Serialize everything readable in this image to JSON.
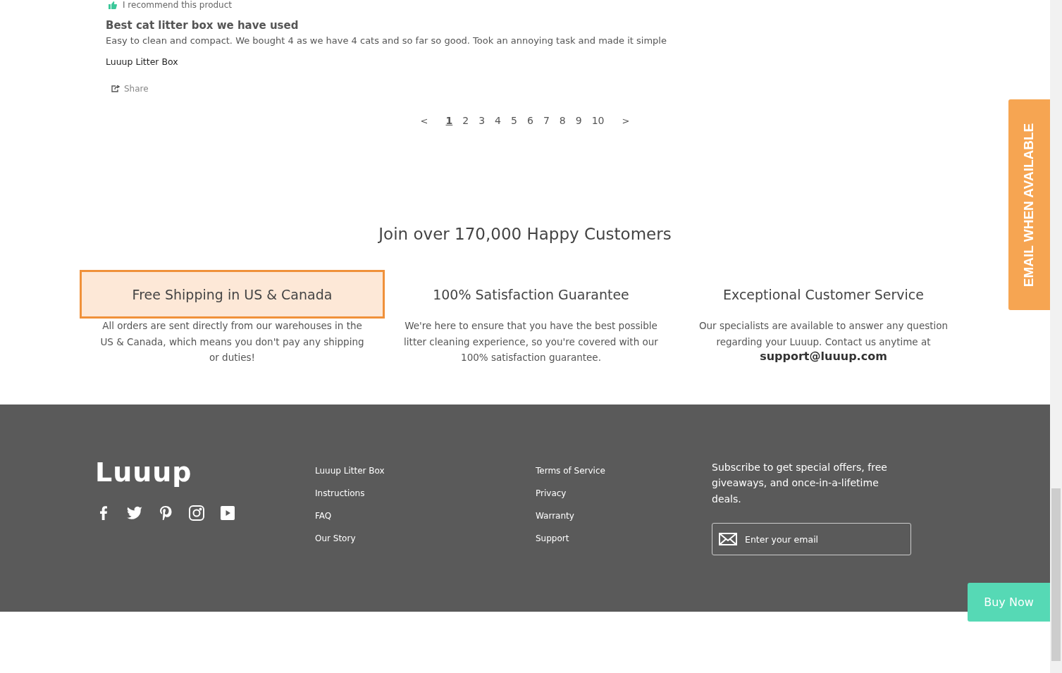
{
  "review": {
    "recommend": "I recommend this product",
    "title": "Best cat litter box we have used",
    "body": "Easy to clean and compact. We bought 4 as we have 4 cats and so far so good. Took an annoying task and made it simple",
    "product": "Luuup Litter Box",
    "share": "Share"
  },
  "pagination": {
    "prev": "<",
    "next": ">",
    "pages": [
      {
        "label": "1",
        "selected": true
      },
      {
        "label": "2",
        "selected": false
      },
      {
        "label": "3",
        "selected": false
      },
      {
        "label": "4",
        "selected": false
      },
      {
        "label": "5",
        "selected": false
      },
      {
        "label": "6",
        "selected": false
      },
      {
        "label": "7",
        "selected": false
      },
      {
        "label": "8",
        "selected": false
      },
      {
        "label": "9",
        "selected": false
      },
      {
        "label": "10",
        "selected": false
      }
    ]
  },
  "features": {
    "heading": "Join over 170,000 Happy Customers",
    "items": [
      {
        "title": "Free Shipping in US & Canada",
        "highlighted": true,
        "text": "All orders are sent directly from our warehouses in the US & Canada, which means you don't pay any shipping or duties!"
      },
      {
        "title": "100% Satisfaction Guarantee",
        "highlighted": false,
        "text": "We're here to ensure that you have the best possible litter cleaning experience, so you're covered with our 100% satisfaction guarantee."
      },
      {
        "title": "Exceptional Customer Service",
        "highlighted": false,
        "text": "Our specialists are available to answer any question regarding your Luuup. Contact us anytime at",
        "email": "support@luuup.com"
      }
    ]
  },
  "footer": {
    "logo": "Luuup",
    "social": [
      {
        "kind": "facebook"
      },
      {
        "kind": "twitter"
      },
      {
        "kind": "pinterest"
      },
      {
        "kind": "instagram"
      },
      {
        "kind": "youtube"
      }
    ],
    "links_1": [
      "Luuup Litter Box",
      "Instructions",
      "FAQ",
      "Our Story"
    ],
    "links_2": [
      "Terms of Service",
      "Privacy",
      "Warranty",
      "Support"
    ],
    "subscribe": "Subscribe to get special offers, free giveaways, and once-in-a-lifetime deals.",
    "email_placeholder": "Enter your email"
  },
  "email_tab": "EMAIL WHEN AVAILABLE",
  "buy_now": "Buy Now"
}
